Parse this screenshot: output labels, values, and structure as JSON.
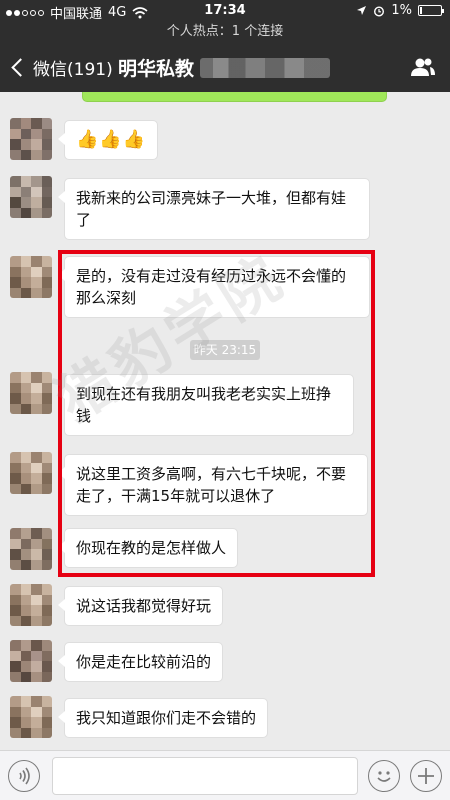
{
  "status_bar": {
    "carrier": "中国联通",
    "network": "4G",
    "time": "17:34",
    "battery": "1%"
  },
  "hotspot": {
    "text": "个人热点：1 个连接"
  },
  "nav": {
    "back_label": "微信(191)",
    "title": "明华私教"
  },
  "messages": [
    {
      "text": "👍👍👍"
    },
    {
      "text": "我新来的公司漂亮妹子一大堆，但都有娃了"
    },
    {
      "text": "是的，没有走过没有经历过永远不会懂的那么深刻"
    },
    {
      "text": "到现在还有我朋友叫我老老实实上班挣钱"
    },
    {
      "text": "说这里工资多高啊，有六七千块呢，不要走了，干满15年就可以退休了"
    },
    {
      "text": "你现在教的是怎样做人"
    },
    {
      "text": "说这话我都觉得好玩"
    },
    {
      "text": "你是走在比较前沿的"
    },
    {
      "text": "我只知道跟你们走不会错的"
    }
  ],
  "timestamp": "昨天 23:15",
  "watermark": "猎豹学院",
  "icons": {
    "back": "chevron-left-icon",
    "contacts": "people-icon",
    "voice": "voice-icon",
    "emoji": "emoji-icon",
    "plus": "plus-icon",
    "location": "location-icon",
    "alarm": "alarm-icon"
  }
}
